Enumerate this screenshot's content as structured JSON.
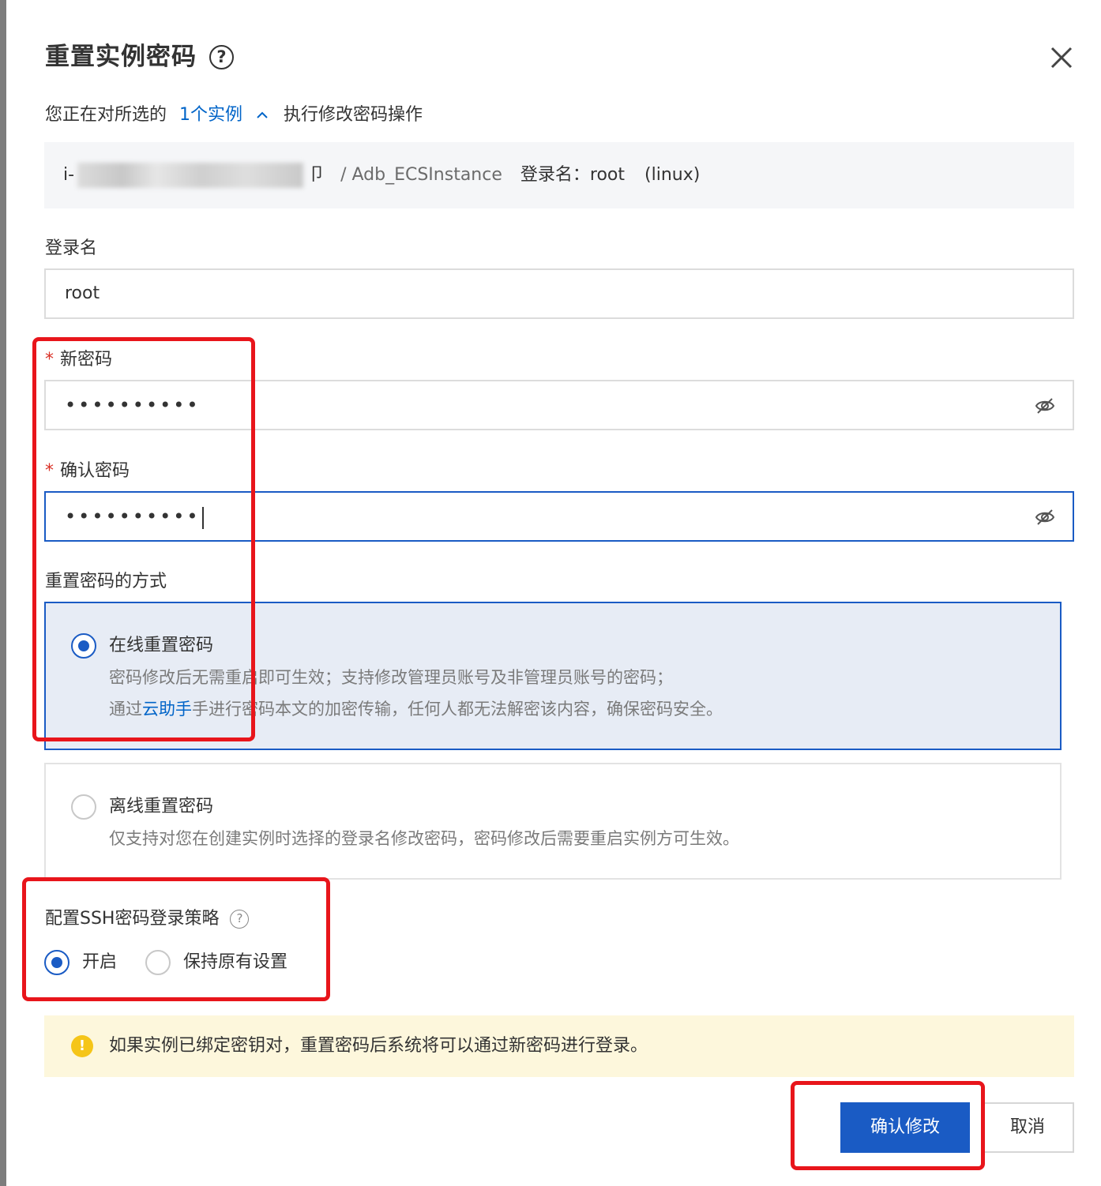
{
  "dialog": {
    "title": "重置实例密码",
    "help_glyph": "?",
    "close_icon": "close-icon"
  },
  "summary": {
    "prefix": "您正在对所选的",
    "count_link": "1个实例",
    "suffix": "执行修改密码操作"
  },
  "instance": {
    "id_start": "i-",
    "id_end": "卩",
    "name": "/ Adb_ECSInstance",
    "login_label": "登录名：",
    "login_value": "root",
    "os": "(linux)"
  },
  "form": {
    "login_name": {
      "label": "登录名",
      "value": "root"
    },
    "new_password": {
      "required": "*",
      "label": "新密码",
      "value": "••••••••••"
    },
    "confirm_password": {
      "required": "*",
      "label": "确认密码",
      "value": "••••••••••"
    },
    "reset_method": {
      "label": "重置密码的方式",
      "options": [
        {
          "title": "在线重置密码",
          "selected": true,
          "desc1": "密码修改后无需重启即可生效；支持修改管理员账号及非管理员账号的密码；",
          "desc2_prefix": "通过",
          "desc2_link": "云助手",
          "desc2_suffix": "手进行密码本文的加密传输，任何人都无法解密该内容，确保密码安全。"
        },
        {
          "title": "离线重置密码",
          "selected": false,
          "desc1": "仅支持对您在创建实例时选择的登录名修改密码，密码修改后需要重启实例方可生效。"
        }
      ]
    },
    "ssh_policy": {
      "label": "配置SSH密码登录策略",
      "help_glyph": "?",
      "options": [
        {
          "label": "开启",
          "selected": true
        },
        {
          "label": "保持原有设置",
          "selected": false
        }
      ]
    }
  },
  "alert": {
    "icon": "!",
    "text": "如果实例已绑定密钥对，重置密码后系统将可以通过新密码进行登录。"
  },
  "footer": {
    "confirm_label": "确认修改",
    "cancel_label": "取消"
  },
  "colors": {
    "primary": "#1a5bc4",
    "link": "#0064c8",
    "required": "#d93026",
    "annotation": "#e8151b",
    "alert_bg": "#fdf7dc"
  }
}
